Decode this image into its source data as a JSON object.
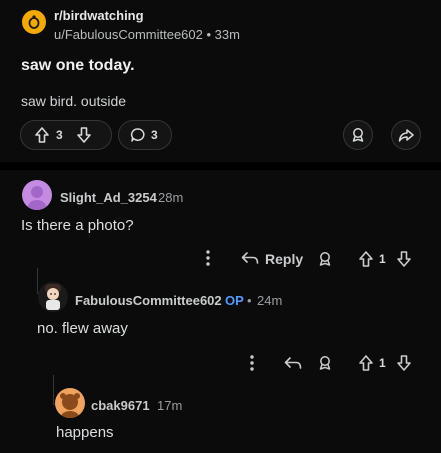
{
  "post": {
    "subreddit": "r/birdwatching",
    "author": "u/FabulousCommittee602",
    "separator": "•",
    "age": "33m",
    "title": "saw one today.",
    "body": "saw bird. outside",
    "votes": "3",
    "comments": "3"
  },
  "comments": [
    {
      "author": "Slight_Ad_3254",
      "age": "28m",
      "text": "Is there a photo?",
      "reply_label": "Reply",
      "votes": "1"
    },
    {
      "author": "FabulousCommittee602",
      "op_label": "OP",
      "separator": "•",
      "age": "24m",
      "text": "no. flew away",
      "votes": "1"
    },
    {
      "author": "cbak9671",
      "age": "17m",
      "text": "happens"
    }
  ],
  "icons": {
    "subreddit": "subreddit-icon",
    "upvote": "upvote-arrow-icon",
    "downvote": "downvote-arrow-icon",
    "comment": "comment-bubble-icon",
    "award": "award-icon",
    "share": "share-icon",
    "more": "more-vertical-icon",
    "reply": "reply-arrow-icon"
  },
  "colors": {
    "background": "#0b0b0b",
    "accent_op": "#4f9bff",
    "subreddit_icon": "#f2a900"
  }
}
